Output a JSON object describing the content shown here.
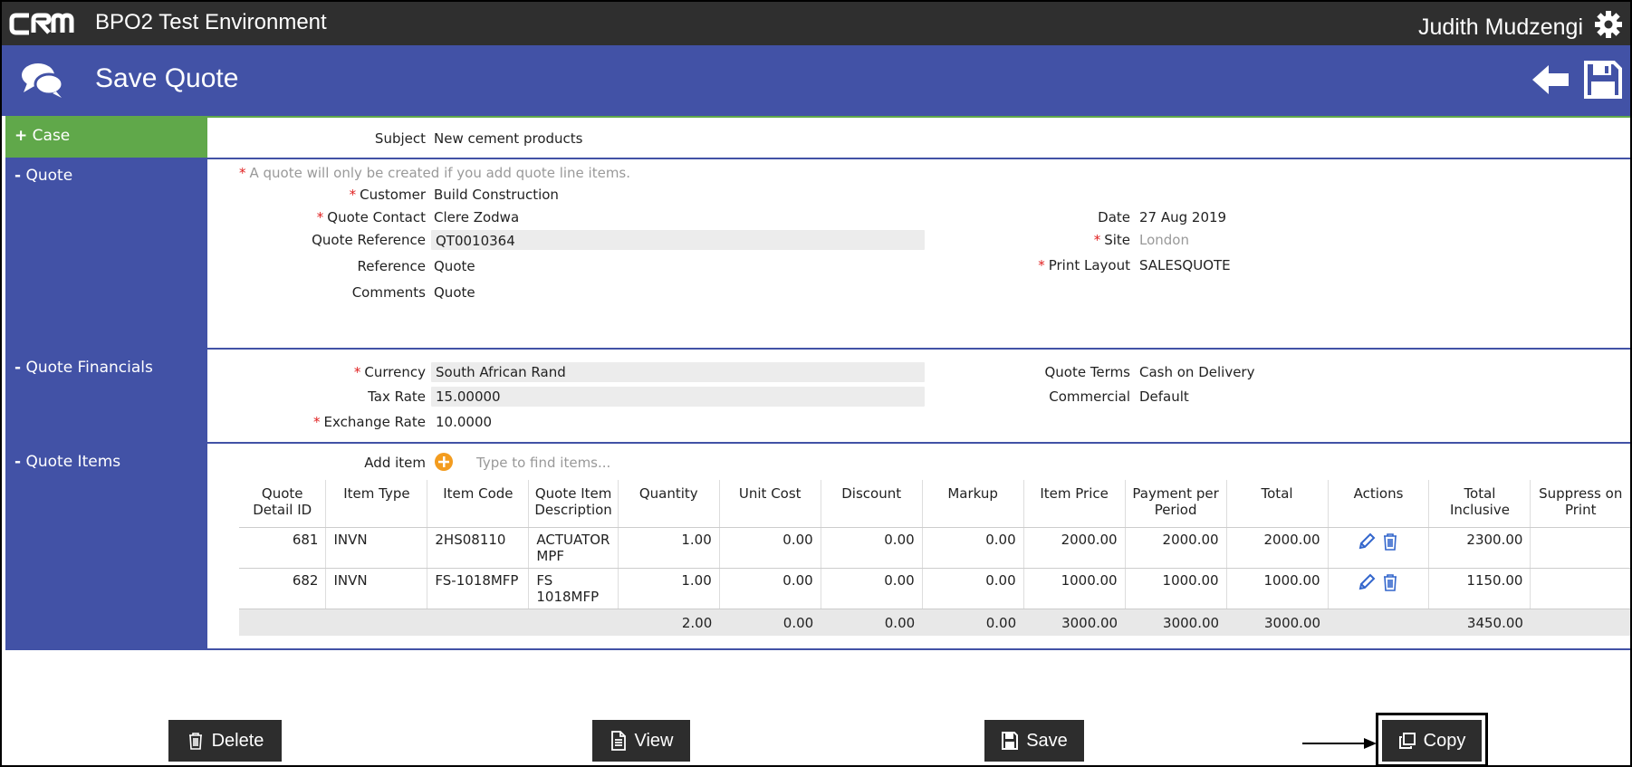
{
  "app": {
    "environment": "BPO2 Test Environment",
    "logo_text": "CRM",
    "user": "Judith Mudzengi"
  },
  "header": {
    "title": "Save Quote"
  },
  "icons": {
    "logo": "crm-logo",
    "settings": "gear-icon",
    "header": "chat-bubbles-icon",
    "back": "back-arrow-icon",
    "save": "floppy-disk-icon",
    "add": "plus-circle-icon",
    "edit": "pencil-icon",
    "delete": "trash-icon"
  },
  "colors": {
    "topbar": "#2f2f2f",
    "header": "#4252a6",
    "case_section": "#60a84a",
    "required": "#e02020",
    "add_icon": "#f39c1f",
    "action_icon": "#3366cc"
  },
  "case": {
    "label": "Case",
    "toggle": "+",
    "subject_label": "Subject",
    "subject_value": "New cement products"
  },
  "quote": {
    "label": "Quote",
    "toggle": "-",
    "required_mark": "*",
    "note": "A quote will only be created if you add quote line items.",
    "customer_label": "Customer",
    "customer_value": "Build Construction",
    "contact_label": "Quote Contact",
    "contact_value": "Clere Zodwa",
    "reference_no_label": "Quote Reference",
    "reference_no_value": "QT0010364",
    "reference_label": "Reference",
    "reference_value": "Quote",
    "comments_label": "Comments",
    "comments_value": "Quote",
    "date_label": "Date",
    "date_value": "27 Aug 2019",
    "site_label": "Site",
    "site_placeholder": "London",
    "print_label": "Print Layout",
    "print_value": "SALESQUOTE"
  },
  "financials": {
    "label": "Quote Financials",
    "toggle": "-",
    "currency_label": "Currency",
    "currency_value": "South African Rand",
    "tax_label": "Tax Rate",
    "tax_value": "15.00000",
    "exchange_label": "Exchange Rate",
    "exchange_value": "10.0000",
    "terms_label": "Quote Terms",
    "terms_value": "Cash on Delivery",
    "commercial_label": "Commercial",
    "commercial_value": "Default"
  },
  "items": {
    "label": "Quote Items",
    "toggle": "-",
    "add_label": "Add item",
    "add_placeholder": "Type to find items...",
    "columns": [
      "Quote Detail ID",
      "Item Type",
      "Item Code",
      "Quote Item Description",
      "Quantity",
      "Unit Cost",
      "Discount",
      "Markup",
      "Item Price",
      "Payment per Period",
      "Total",
      "Actions",
      "Total Inclusive",
      "Suppress on Print"
    ],
    "rows": [
      {
        "id": "681",
        "type": "INVN",
        "code": "2HS08110",
        "desc": "ACTUATOR MPF",
        "qty": "1.00",
        "unit_cost": "0.00",
        "discount": "0.00",
        "markup": "0.00",
        "price": "2000.00",
        "per_period": "2000.00",
        "total": "2000.00",
        "total_incl": "2300.00",
        "suppress": ""
      },
      {
        "id": "682",
        "type": "INVN",
        "code": "FS-1018MFP",
        "desc": "FS 1018MFP",
        "qty": "1.00",
        "unit_cost": "0.00",
        "discount": "0.00",
        "markup": "0.00",
        "price": "1000.00",
        "per_period": "1000.00",
        "total": "1000.00",
        "total_incl": "1150.00",
        "suppress": ""
      }
    ],
    "totals": {
      "qty": "2.00",
      "unit_cost": "0.00",
      "discount": "0.00",
      "markup": "0.00",
      "price": "3000.00",
      "per_period": "3000.00",
      "total": "3000.00",
      "total_incl": "3450.00"
    }
  },
  "buttons": {
    "delete": "Delete",
    "view": "View",
    "save": "Save",
    "copy": "Copy"
  }
}
